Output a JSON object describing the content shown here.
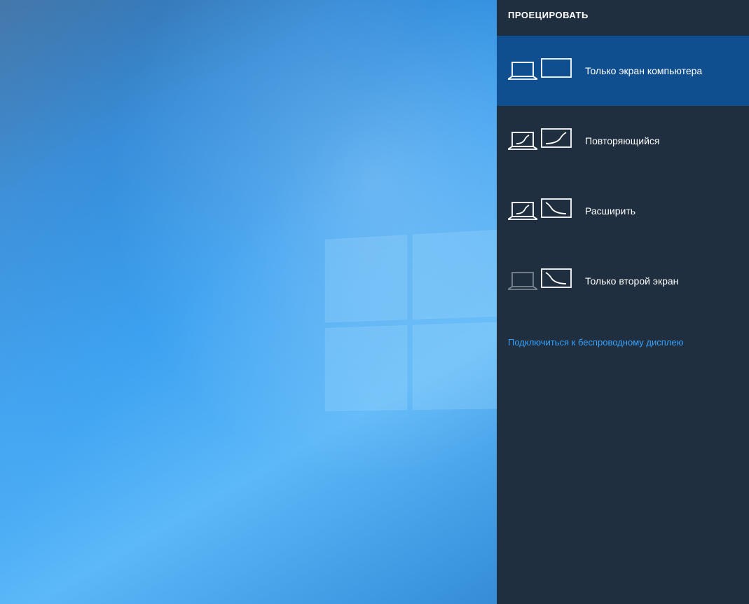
{
  "panel": {
    "title": "ПРОЕЦИРОВАТЬ",
    "options": [
      {
        "label": "Только экран компьютера"
      },
      {
        "label": "Повторяющийся"
      },
      {
        "label": "Расширить"
      },
      {
        "label": "Только второй экран"
      }
    ],
    "wireless_link": "Подключиться к беспроводному дисплею"
  }
}
